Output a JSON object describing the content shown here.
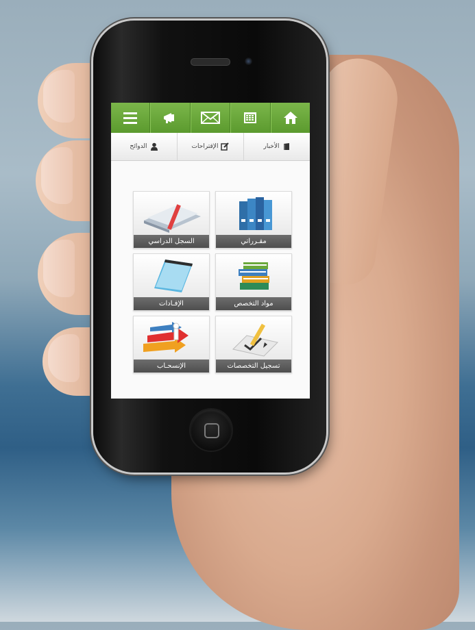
{
  "colors": {
    "topbar_green": "#6aa83b",
    "label_bar": "#5a5a5a",
    "screen_bg": "#f2f2f2"
  },
  "topbar": {
    "icons": [
      "home-icon",
      "calendar-icon",
      "mail-icon",
      "megaphone-icon",
      "menu-icon"
    ]
  },
  "subnav": {
    "items": [
      {
        "label": "الأخبار",
        "icon": "newspaper-icon"
      },
      {
        "label": "الإقتراحات",
        "icon": "edit-icon"
      },
      {
        "label": "الدوائح",
        "icon": "user-icon"
      }
    ]
  },
  "tiles": [
    {
      "label": "مقـرراتي",
      "icon": "binders-icon"
    },
    {
      "label": "السجل الدراسي",
      "icon": "book-ribbon-icon"
    },
    {
      "label": "مواد التخصص",
      "icon": "book-stack-icon"
    },
    {
      "label": "الإفـادات",
      "icon": "notepad-icon"
    },
    {
      "label": "تسجيل التخصصات",
      "icon": "pencil-check-icon"
    },
    {
      "label": "الإنسحـاب",
      "icon": "arrows-person-icon"
    }
  ]
}
